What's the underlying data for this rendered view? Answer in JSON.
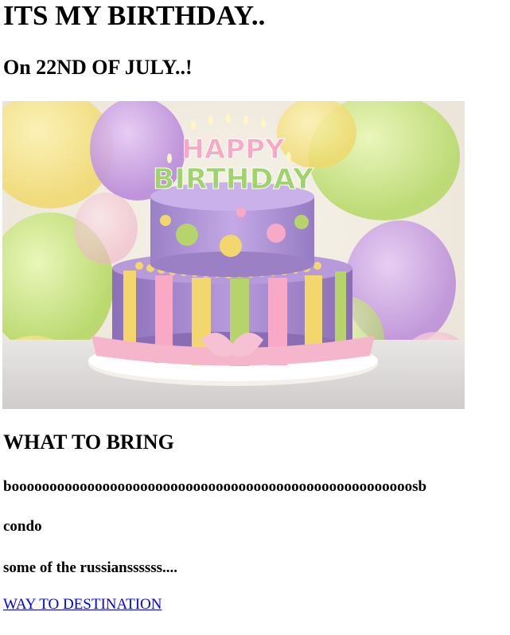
{
  "heading": "ITS MY BIRTHDAY..",
  "subheading": "On 22ND OF JULY..!",
  "image": {
    "topper_line1": "HAPPY",
    "topper_line2": "BIRTHDAY"
  },
  "bring": {
    "title": "WHAT TO BRING",
    "items": [
      "booooooooooooooooooooooooooooooooooooooooooooooooooooosb",
      "condo",
      "some of the russianssssss...."
    ]
  },
  "link": {
    "label": "WAY TO DESTINATION"
  },
  "colors": {
    "link": "#0000ee",
    "text": "#000000",
    "background": "#ffffff"
  }
}
